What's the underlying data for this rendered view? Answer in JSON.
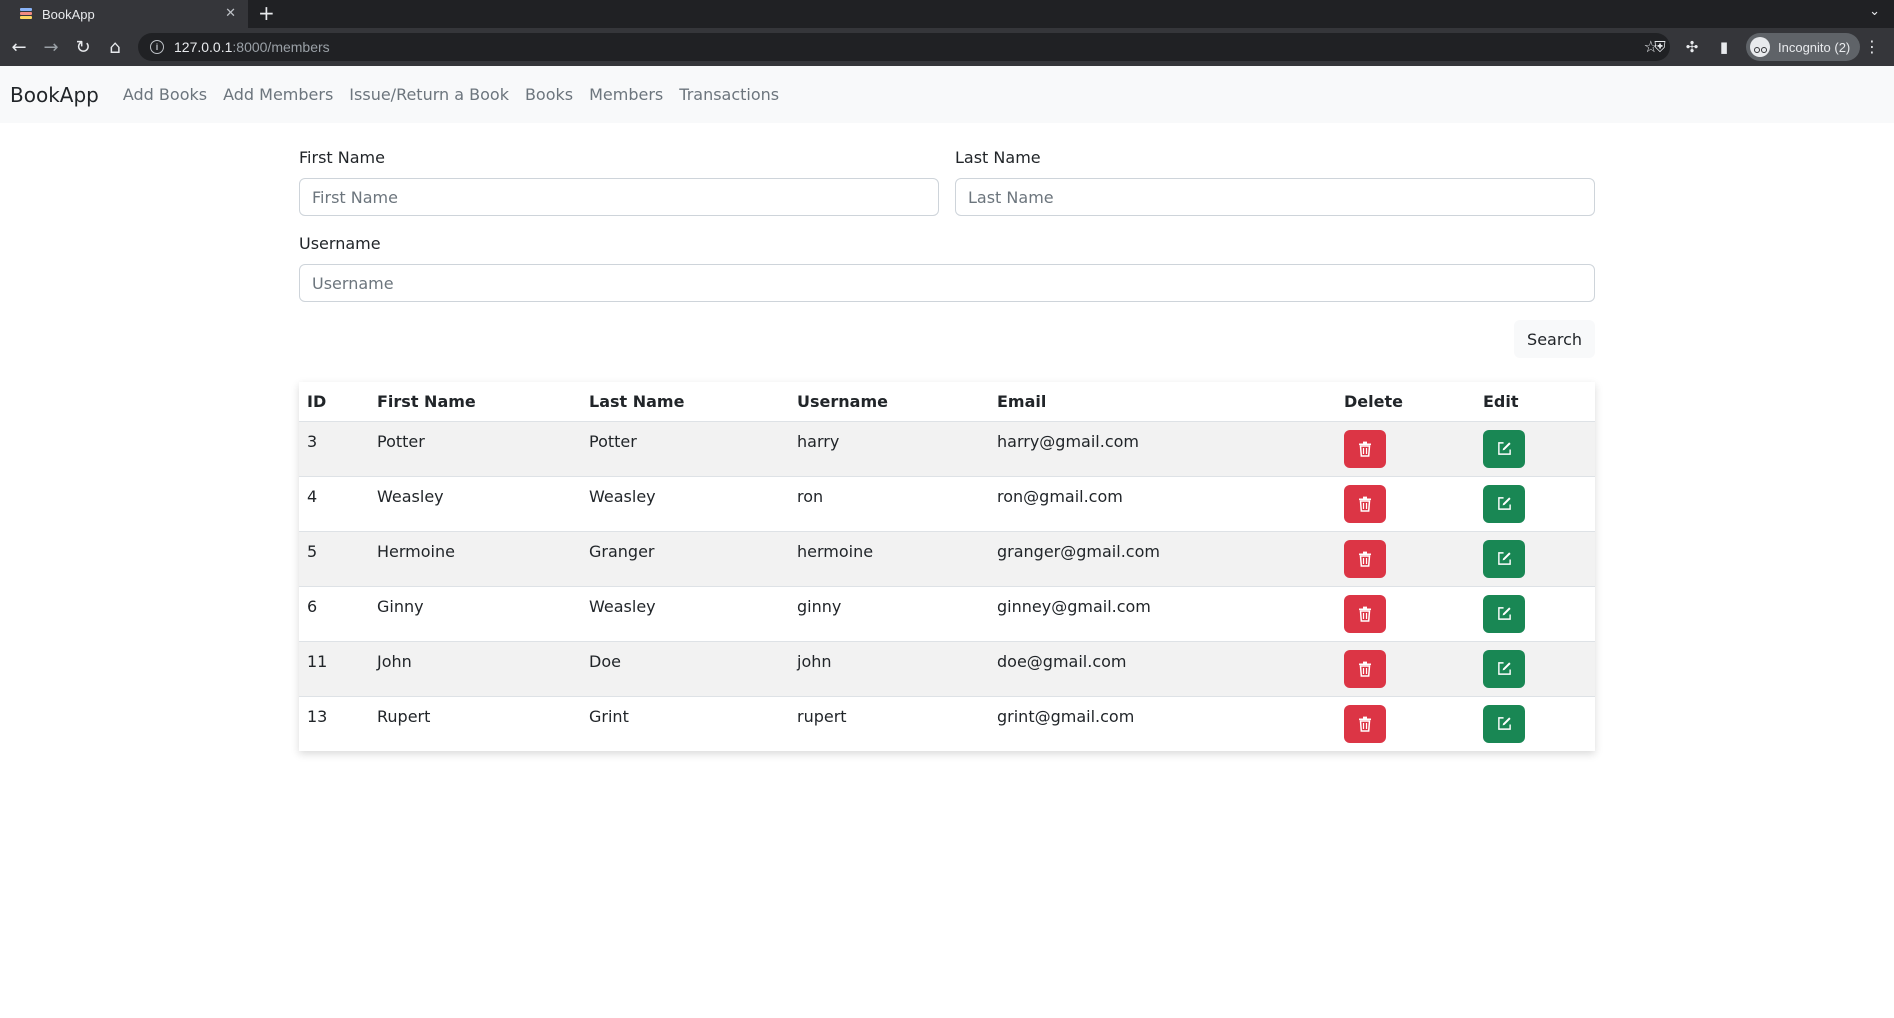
{
  "browser": {
    "tab_title": "BookApp",
    "url_host": "127.0.0.1",
    "url_rest": ":8000/members",
    "profile_label": "Incognito (2)"
  },
  "nav": {
    "brand": "BookApp",
    "links": [
      "Add Books",
      "Add Members",
      "Issue/Return a Book",
      "Books",
      "Members",
      "Transactions"
    ]
  },
  "form": {
    "first_name_label": "First Name",
    "first_name_placeholder": "First Name",
    "last_name_label": "Last Name",
    "last_name_placeholder": "Last Name",
    "username_label": "Username",
    "username_placeholder": "Username",
    "search_label": "Search"
  },
  "table": {
    "headers": [
      "ID",
      "First Name",
      "Last Name",
      "Username",
      "Email",
      "Delete",
      "Edit"
    ],
    "rows": [
      {
        "id": "3",
        "first": "Potter",
        "last": "Potter",
        "username": "harry",
        "email": "harry@gmail.com"
      },
      {
        "id": "4",
        "first": "Weasley",
        "last": "Weasley",
        "username": "ron",
        "email": "ron@gmail.com"
      },
      {
        "id": "5",
        "first": "Hermoine",
        "last": "Granger",
        "username": "hermoine",
        "email": "granger@gmail.com"
      },
      {
        "id": "6",
        "first": "Ginny",
        "last": "Weasley",
        "username": "ginny",
        "email": "ginney@gmail.com"
      },
      {
        "id": "11",
        "first": "John",
        "last": "Doe",
        "username": "john",
        "email": "doe@gmail.com"
      },
      {
        "id": "13",
        "first": "Rupert",
        "last": "Grint",
        "username": "rupert",
        "email": "grint@gmail.com"
      }
    ]
  },
  "icons": {
    "delete": "trash-icon",
    "edit": "pencil-square-icon"
  },
  "colors": {
    "danger": "#dc3545",
    "success": "#198754"
  }
}
